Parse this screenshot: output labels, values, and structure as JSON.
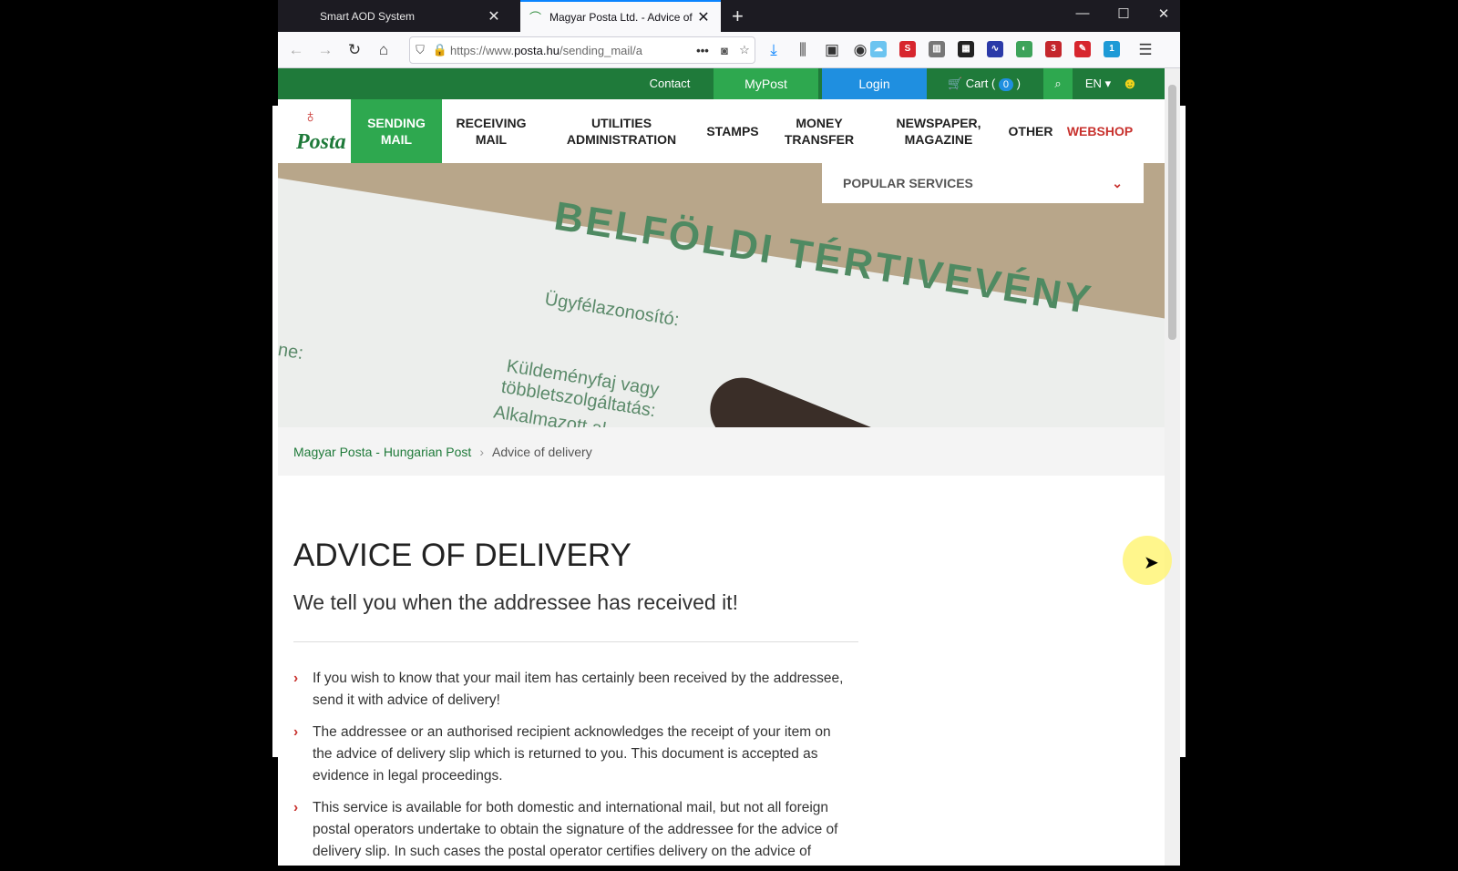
{
  "browser": {
    "tabs": [
      {
        "title": "Smart AOD System",
        "active": false
      },
      {
        "title": "Magyar Posta Ltd. - Advice of d",
        "active": true
      }
    ],
    "url_prefix": "https://www.",
    "url_domain": "posta.hu",
    "url_path": "/sending_mail/a",
    "ext_badges": {
      "shield_count": "3",
      "ghost_count": "1"
    }
  },
  "site": {
    "topbar": {
      "contact": "Contact",
      "mypost": "MyPost",
      "login": "Login",
      "cart": "Cart (",
      "cart_count": "0",
      "cart_close": ")",
      "lang": "EN"
    },
    "logo_text": "Posta",
    "menu": [
      {
        "label": "SENDING MAIL"
      },
      {
        "label": "RECEIVING MAIL"
      },
      {
        "label": "UTILITIES ADMINISTRATION"
      },
      {
        "label": "STAMPS"
      },
      {
        "label": "MONEY TRANSFER"
      },
      {
        "label": "NEWSPAPER, MAGAZINE"
      },
      {
        "label": "OTHER"
      },
      {
        "label": "WEBSHOP"
      }
    ],
    "popular_services": "POPULAR SERVICES",
    "hero": {
      "title": "BELFÖLDI TÉRTIVEVÉNY",
      "line1": "Ügyfélazonosító:",
      "line2": "Küldeményfaj vagy",
      "line3": "többletszolgáltatás:",
      "line4": "Alkalmazott al",
      "line5": "ne:"
    },
    "breadcrumb": {
      "home": "Magyar Posta - Hungarian Post",
      "current": "Advice of delivery"
    },
    "heading": "ADVICE OF DELIVERY",
    "subheading": "We tell you when the addressee has received it!",
    "bullets": [
      "If you wish to know that your mail item has certainly been received by the addressee, send it with advice of delivery!",
      "The addressee or an authorised recipient acknowledges the receipt of your item on the advice of delivery slip which is returned to you. This document is accepted as evidence in legal proceedings.",
      "This service is available for both domestic and international mail, but not all foreign postal operators undertake to obtain the signature of the addressee for the advice of delivery slip. In such cases the postal operator certifies delivery on the advice of"
    ]
  },
  "colors": {
    "brand_green": "#1f7a3a",
    "accent_green": "#2ea84f",
    "login_blue": "#1f8fe0",
    "webshop_red": "#c8322e"
  }
}
